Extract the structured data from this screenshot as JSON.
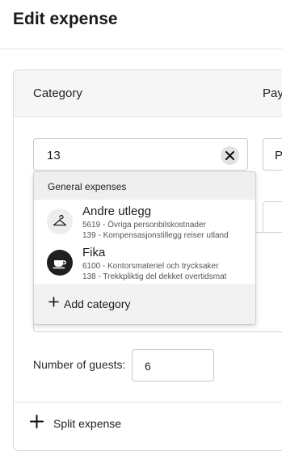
{
  "page": {
    "title": "Edit expense"
  },
  "table": {
    "col_category": "Category",
    "col_payment": "Pay"
  },
  "category_input": {
    "value": "13"
  },
  "payment_input": {
    "value": "Pr"
  },
  "dropdown": {
    "group_label": "General expenses",
    "options": [
      {
        "title": "Andre utlegg",
        "line1": "5619 - Övriga personbilskostnader",
        "line2": "139 - Kompensasjonstillegg reiser utland",
        "icon": "hanger-icon"
      },
      {
        "title": "Fika",
        "line1": "6100 - Kontorsmateriel och trycksaker",
        "line2": "138 - Trekkpliktig del dekket overtidsmat",
        "icon": "coffee-cup-icon"
      }
    ],
    "add_label": "Add category"
  },
  "guests": {
    "label": "Number of guests:",
    "value": "6"
  },
  "split": {
    "label": "Split expense"
  }
}
